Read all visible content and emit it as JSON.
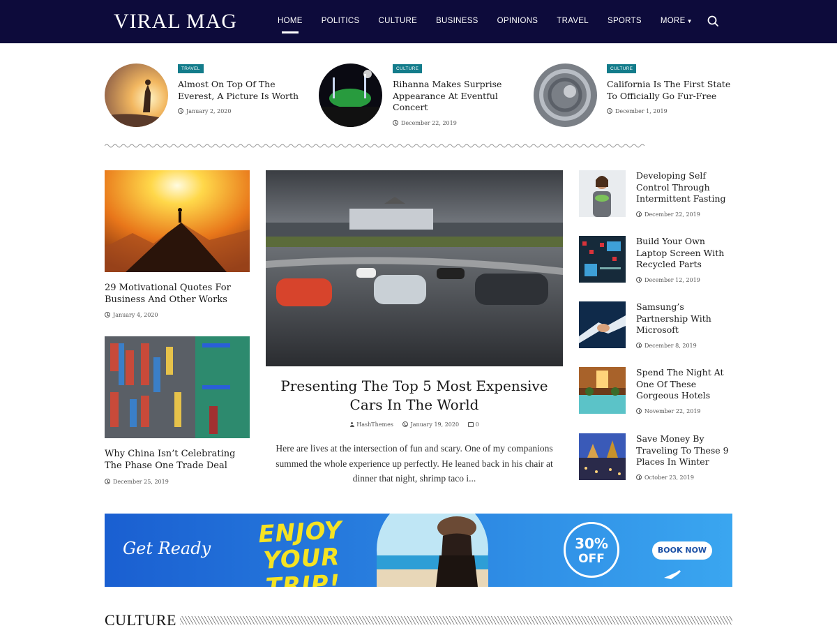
{
  "header": {
    "logo": "VIRAL MAG",
    "nav": [
      "HOME",
      "POLITICS",
      "CULTURE",
      "BUSINESS",
      "OPINIONS",
      "TRAVEL",
      "SPORTS",
      "MORE"
    ],
    "active_nav": "HOME"
  },
  "top_posts": [
    {
      "category": "TRAVEL",
      "title": "Almost On Top Of The Everest, A Picture Is Worth",
      "date": "January 2, 2020"
    },
    {
      "category": "CULTURE",
      "title": "Rihanna Makes Surprise Appearance At Eventful Concert",
      "date": "December 22, 2019"
    },
    {
      "category": "CULTURE",
      "title": "California Is The First State To Officially Go Fur-Free",
      "date": "December 1, 2019"
    }
  ],
  "left_posts": [
    {
      "title": "29 Motivational Quotes For Business And Other Works",
      "date": "January 4, 2020"
    },
    {
      "title": "Why China Isn’t Celebrating The Phase One Trade Deal",
      "date": "December 25, 2019"
    }
  ],
  "featured": {
    "title": "Presenting The Top 5 Most Expensive Cars In The World",
    "author": "HashThemes",
    "date": "January 19, 2020",
    "comments": "0",
    "excerpt": "Here are lives at the intersection of fun and scary. One of my companions summed the whole experience up perfectly. He leaned back in his chair at dinner that night, shrimp taco i..."
  },
  "right_posts": [
    {
      "title": "Developing Self Control Through Intermittent Fasting",
      "date": "December 22, 2019"
    },
    {
      "title": "Build Your Own Laptop Screen With Recycled Parts",
      "date": "December 12, 2019"
    },
    {
      "title": "Samsung’s Partnership With Microsoft",
      "date": "December 8, 2019"
    },
    {
      "title": "Spend The Night At One Of These Gorgeous Hotels",
      "date": "November 22, 2019"
    },
    {
      "title": "Save Money By Traveling To These 9 Places In Winter",
      "date": "October 23, 2019"
    }
  ],
  "banner": {
    "get_ready": "Get Ready",
    "headline_1": "ENJOY",
    "headline_2": "YOUR TRIP!",
    "percent": "30%",
    "off": "OFF",
    "button": "BOOK NOW"
  },
  "section": {
    "title": "CULTURE"
  },
  "colors": {
    "header_bg": "#0d0b3b",
    "badge": "#137c8b",
    "banner_blue": "#1a6fd6",
    "banner_yellow": "#f5e323"
  }
}
